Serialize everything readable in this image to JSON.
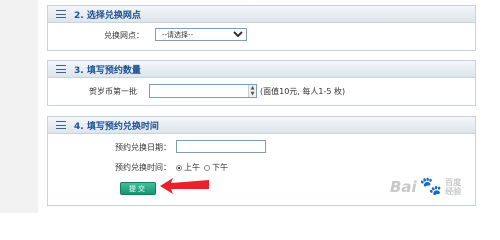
{
  "section2": {
    "title": "2. 选择兑换网点",
    "label": "兑换网点：",
    "select_value": "--请选择--"
  },
  "section3": {
    "title": "3. 填写预约数量",
    "label": "贺岁币第一批",
    "note": "(面值10元, 每人1-5 枚)"
  },
  "section4": {
    "title": "4. 填写预约兑换时间",
    "date_label": "预约兑换日期：",
    "time_label": "预约兑换时间：",
    "am_label": "上午",
    "pm_label": "下午",
    "selected": "上午"
  },
  "submit_label": "提交",
  "watermark": {
    "brand": "Bai",
    "cn": "百度",
    "sub": "经验"
  },
  "colors": {
    "title": "#1d4f91",
    "submit": "#1a9470",
    "arrow": "#e8222a"
  }
}
